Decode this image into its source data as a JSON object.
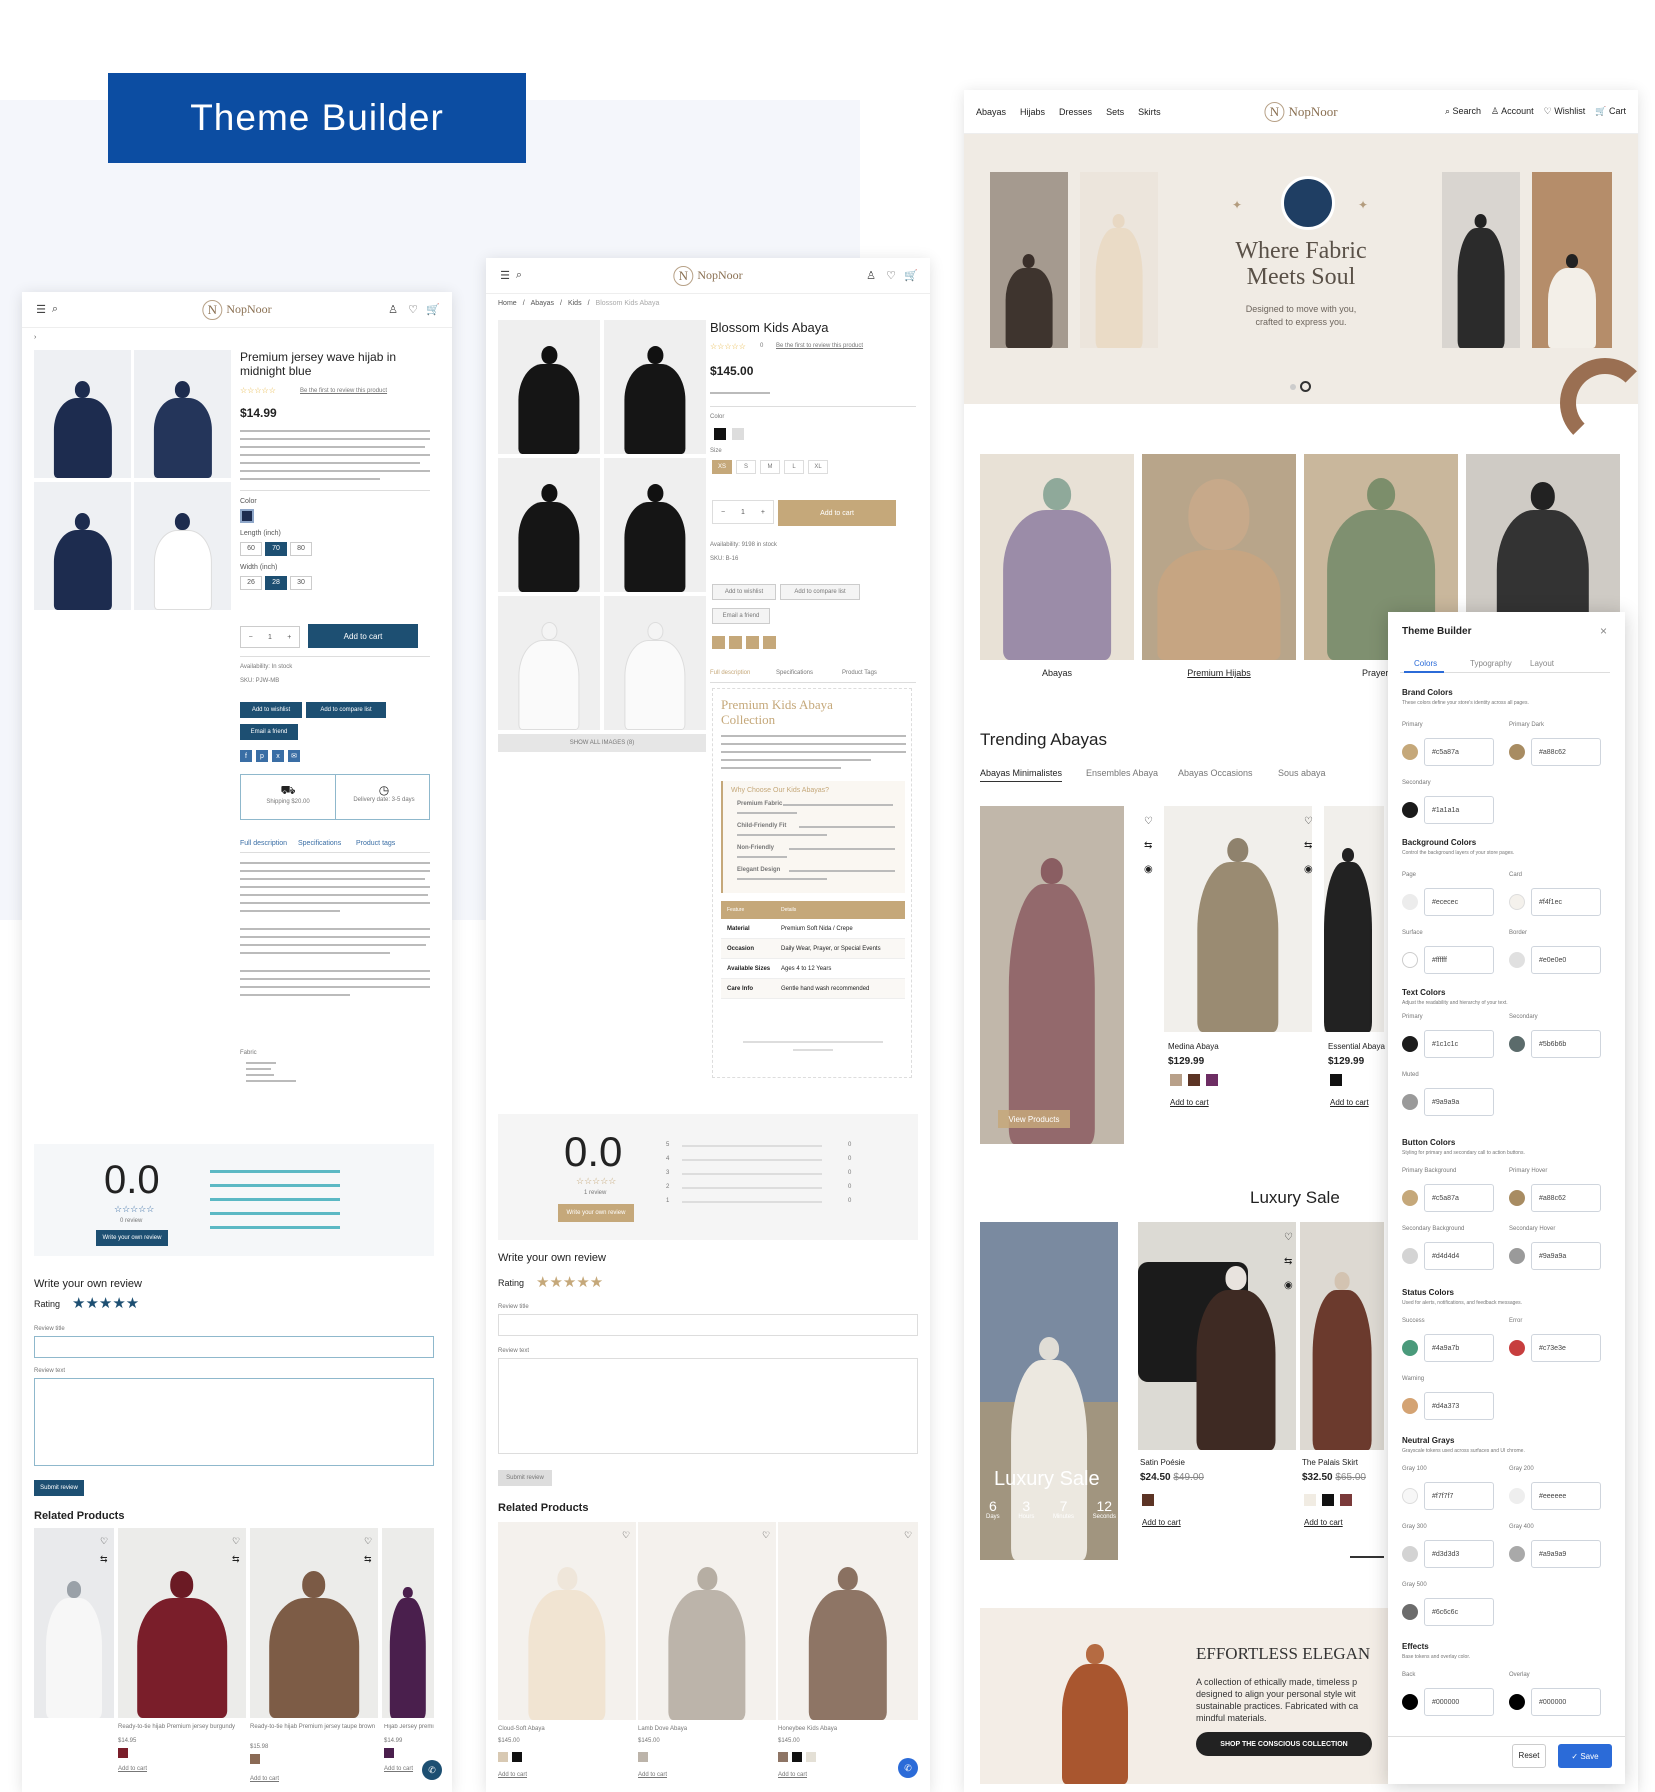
{
  "banner": {
    "title": "Theme Builder"
  },
  "left": {
    "product_title": "Premium jersey wave hijab in midnight blue",
    "price": "$14.99",
    "color_label": "Color",
    "length_label": "Length (inch)",
    "lengths": [
      "60",
      "70",
      "80"
    ],
    "width_label": "Width (inch)",
    "widths": [
      "26",
      "28",
      "30"
    ],
    "qty": "1",
    "add_to_cart": "Add to cart",
    "availability": "Availability: In stock",
    "sku": "SKU: PJW-MB",
    "add_wishlist": "Add to wishlist",
    "add_compare": "Add to compare list",
    "email_friend": "Email a friend",
    "shipping": "Shipping $20.00",
    "delivery": "Delivery date: 3-5 days",
    "tabs": [
      "Full description",
      "Specifications",
      "Product tags"
    ],
    "fabric": "Fabric",
    "rating_value": "0.0",
    "reviews_count": "0 review",
    "write_review_btn": "Write your own review",
    "write_review_heading": "Write your own review",
    "rating_label": "Rating",
    "review_title_label": "Review title",
    "review_text_label": "Review text",
    "submit": "Submit review",
    "related": "Related Products",
    "related_items": [
      {
        "name": "Ready-to-tie hijab Premium jersey burgundy",
        "price": "$14.95"
      },
      {
        "name": "Ready-to-tie hijab Premium jersey taupe brown",
        "price": "$15.98"
      },
      {
        "name": "Hijab Jersey premi",
        "price": "$14.99"
      }
    ],
    "add_to_cart_link": "Add to cart"
  },
  "middle": {
    "crumbs": [
      "Home",
      "Abayas",
      "Kids",
      "Blossom Kids Abaya"
    ],
    "product_title": "Blossom Kids Abaya",
    "review_link": "Be the first to review this product",
    "rating_count": "0",
    "price": "$145.00",
    "color_label": "Color",
    "size_label": "Size",
    "sizes": [
      "XS",
      "S",
      "M",
      "L",
      "XL"
    ],
    "qty": "1",
    "add_to_cart": "Add to cart",
    "availability": "Availability: 9198 in stock",
    "sku": "SKU: B-16",
    "add_wishlist": "Add to wishlist",
    "add_compare": "Add to compare list",
    "email_friend": "Email a friend",
    "show_all": "SHOW ALL IMAGES (8)",
    "tabs": [
      "Full description",
      "Specifications",
      "Product Tags"
    ],
    "collection_title": "Premium Kids Abaya Collection",
    "why_title": "Why Choose Our Kids Abayas?",
    "features": [
      "Premium Fabric",
      "Child-Friendly Fit",
      "Non-Friendly",
      "Elegant Design"
    ],
    "table_header": [
      "Feature",
      "Details"
    ],
    "table_rows": [
      [
        "Material",
        "Premium Soft Nida / Crepe"
      ],
      [
        "Occasion",
        "Daily Wear, Prayer, or Special Events"
      ],
      [
        "Available Sizes",
        "Ages 4 to 12 Years"
      ],
      [
        "Care Info",
        "Gentle hand wash recommended"
      ]
    ],
    "rating_value": "0.0",
    "reviews_count": "1 review",
    "write_review_btn": "Write your own review",
    "bar_labels": [
      "5",
      "4",
      "3",
      "2",
      "1"
    ],
    "bar_counts": [
      "0",
      "0",
      "0",
      "0",
      "0"
    ],
    "write_review_heading": "Write your own review",
    "rating_label": "Rating",
    "review_title_label": "Review title",
    "review_text_label": "Review text",
    "submit": "Submit review",
    "related": "Related Products",
    "related_items": [
      {
        "name": "Cloud-Soft Abaya",
        "price": "$145.00"
      },
      {
        "name": "Lamb Dove Abaya",
        "price": "$145.00"
      },
      {
        "name": "Honeybee Kids Abaya",
        "price": "$145.00"
      }
    ],
    "add_to_cart_link": "Add to cart"
  },
  "right": {
    "nav": [
      "Abayas",
      "Hijabs",
      "Dresses",
      "Sets",
      "Skirts"
    ],
    "brand": "NopNoor",
    "actions": [
      "Search",
      "Account",
      "Wishlist",
      "Cart"
    ],
    "hero_title_1": "Where Fabric",
    "hero_title_2": "Meets Soul",
    "hero_sub_1": "Designed to move with you,",
    "hero_sub_2": "crafted to express you.",
    "categories": [
      "Abayas",
      "Premium Hijabs",
      "Prayer Dr"
    ],
    "trending": "Trending Abayas",
    "trend_tabs": [
      "Abayas Minimalistes",
      "Ensembles Abaya",
      "Abayas Occasions",
      "Sous abaya"
    ],
    "view_products": "View Products",
    "trend_items": [
      {
        "name": "Medina Abaya",
        "price": "$129.99"
      },
      {
        "name": "Essential Abaya",
        "price": "$129.99"
      }
    ],
    "add_to_cart": "Add to cart",
    "luxury": "Luxury Sale",
    "luxury_overlay": "Luxury Sale",
    "countdown": [
      {
        "v": "6",
        "l": "Days"
      },
      {
        "v": "3",
        "l": "Hours"
      },
      {
        "v": "7",
        "l": "Minutes"
      },
      {
        "v": "12",
        "l": "Seconds"
      }
    ],
    "sale_items": [
      {
        "name": "Satin Poésie",
        "price": "$24.50",
        "old": "$49.00"
      },
      {
        "name": "The Palais Skirt",
        "price": "$32.50",
        "old": "$65.00"
      }
    ],
    "effortless": "EFFORTLESS ELEGAN",
    "effortless_text": "A collection of ethically made, timeless p designed to align your personal style wit sustainable practices. Fabricated with ca mindful materials.",
    "shop_btn": "SHOP THE CONSCIOUS COLLECTION"
  },
  "theme_builder": {
    "title": "Theme Builder",
    "tabs": [
      "Colors",
      "Typography",
      "Layout"
    ],
    "brand_colors": "Brand Colors",
    "brand_desc": "These colors define your store's identity across all pages.",
    "primary": "Primary",
    "primary_val": "#c5a87a",
    "primary_dark": "Primary Dark",
    "primary_dark_val": "#a88c62",
    "secondary": "Secondary",
    "secondary_val": "#1a1a1a",
    "bg_colors": "Background Colors",
    "bg_desc": "Control the background layers of your store pages.",
    "page": "Page",
    "page_val": "#ececec",
    "card": "Card",
    "card_val": "#f4f1ec",
    "surface": "Surface",
    "surface_val": "#ffffff",
    "border": "Border",
    "border_val": "#e0e0e0",
    "text_colors": "Text Colors",
    "text_desc": "Adjust the readability and hierarchy of your text.",
    "text_primary": "Primary",
    "text_primary_val": "#1c1c1c",
    "text_secondary": "Secondary",
    "text_secondary_val": "#5b6b6b",
    "muted": "Muted",
    "muted_val": "#9a9a9a",
    "button_colors": "Button Colors",
    "button_desc": "Styling for primary and secondary call to action buttons.",
    "pbg": "Primary Background",
    "pbg_val": "#c5a87a",
    "phover": "Primary Hover",
    "phover_val": "#a88c62",
    "sbg": "Secondary Background",
    "sbg_val": "#d4d4d4",
    "shover": "Secondary Hover",
    "shover_val": "#9a9a9a",
    "status_colors": "Status Colors",
    "status_desc": "Used for alerts, notifications, and feedback messages.",
    "success": "Success",
    "success_val": "#4a9a7b",
    "error": "Error",
    "error_val": "#c73e3e",
    "warning": "Warning",
    "warning_val": "#d4a373",
    "neutral": "Neutral Grays",
    "neutral_desc": "Grayscale tokens used across surfaces and UI chrome.",
    "g100": "Gray 100",
    "g100_val": "#f7f7f7",
    "g200": "Gray 200",
    "g200_val": "#eeeeee",
    "g300": "Gray 300",
    "g300_val": "#d3d3d3",
    "g400": "Gray 400",
    "g400_val": "#a9a9a9",
    "g500": "Gray 500",
    "g500_val": "#6c6c6c",
    "effects": "Effects",
    "effects_desc": "Base tokens and overlay color.",
    "back": "Back",
    "back_val": "#000000",
    "overlay": "Overlay",
    "overlay_val": "#000000",
    "reset": "Reset",
    "save": "Save"
  },
  "colors": {
    "brand_blue": "#0c4da2",
    "gold": "#c5a87a",
    "navy": "#1d4f72",
    "teal": "#5bb8c4"
  }
}
